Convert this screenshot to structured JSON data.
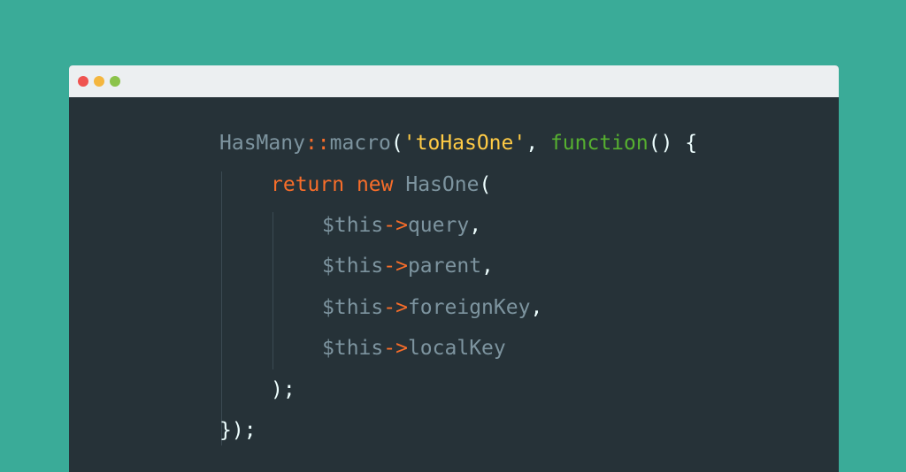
{
  "window": {
    "controls": [
      {
        "name": "close",
        "color": "#ef5350"
      },
      {
        "name": "minimize",
        "color": "#f4b63f"
      },
      {
        "name": "maximize",
        "color": "#8bc34a"
      }
    ]
  },
  "code": {
    "lines": [
      {
        "indent": 0,
        "tokens": [
          {
            "text": "HasMany",
            "kind": "plain"
          },
          {
            "text": "::",
            "kind": "op"
          },
          {
            "text": "macro",
            "kind": "plain"
          },
          {
            "text": "(",
            "kind": "punct"
          },
          {
            "text": "'toHasOne'",
            "kind": "str"
          },
          {
            "text": ", ",
            "kind": "punct"
          },
          {
            "text": "function",
            "kind": "fn"
          },
          {
            "text": "() {",
            "kind": "punct"
          }
        ]
      },
      {
        "indent": 1,
        "tokens": [
          {
            "text": "return",
            "kind": "kw"
          },
          {
            "text": " ",
            "kind": "punct"
          },
          {
            "text": "new",
            "kind": "kw"
          },
          {
            "text": " ",
            "kind": "punct"
          },
          {
            "text": "HasOne",
            "kind": "plain"
          },
          {
            "text": "(",
            "kind": "punct"
          }
        ]
      },
      {
        "indent": 2,
        "tokens": [
          {
            "text": "$this",
            "kind": "plain"
          },
          {
            "text": "->",
            "kind": "op"
          },
          {
            "text": "query",
            "kind": "plain"
          },
          {
            "text": ",",
            "kind": "punct"
          }
        ]
      },
      {
        "indent": 2,
        "tokens": [
          {
            "text": "$this",
            "kind": "plain"
          },
          {
            "text": "->",
            "kind": "op"
          },
          {
            "text": "parent",
            "kind": "plain"
          },
          {
            "text": ",",
            "kind": "punct"
          }
        ]
      },
      {
        "indent": 2,
        "tokens": [
          {
            "text": "$this",
            "kind": "plain"
          },
          {
            "text": "->",
            "kind": "op"
          },
          {
            "text": "foreignKey",
            "kind": "plain"
          },
          {
            "text": ",",
            "kind": "punct"
          }
        ]
      },
      {
        "indent": 2,
        "tokens": [
          {
            "text": "$this",
            "kind": "plain"
          },
          {
            "text": "->",
            "kind": "op"
          },
          {
            "text": "localKey",
            "kind": "plain"
          }
        ]
      },
      {
        "indent": 1,
        "tokens": [
          {
            "text": ");",
            "kind": "punct"
          }
        ]
      },
      {
        "indent": 0,
        "tokens": [
          {
            "text": "});",
            "kind": "punct"
          }
        ]
      }
    ]
  }
}
